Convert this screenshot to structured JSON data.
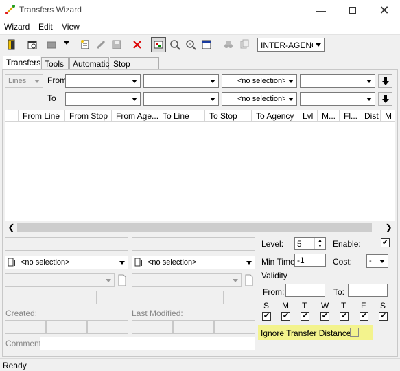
{
  "window": {
    "title": "Transfers Wizard"
  },
  "menu": [
    "Wizard",
    "Edit",
    "View"
  ],
  "toolbar": {
    "agency_select": "INTER-AGENCY"
  },
  "tabs": [
    "Transfers",
    "Tools",
    "Automatic",
    "Stop Clusters"
  ],
  "filters": {
    "lines_label": "Lines",
    "from_label": "From",
    "to_label": "To",
    "from_selection": "<no selection>",
    "to_selection": "<no selection>"
  },
  "columns": [
    "From Line",
    "From Stop",
    "From Age...",
    "To Line",
    "To Stop",
    "To Agency",
    "Lvl",
    "M...",
    "Fl...",
    "Dist",
    "M"
  ],
  "detail": {
    "left_selection": "<no selection>",
    "right_selection": "<no selection>",
    "created_label": "Created:",
    "modified_label": "Last Modified:",
    "comment_label": "Comment:"
  },
  "settings": {
    "level_label": "Level:",
    "level_value": "5",
    "enable_label": "Enable:",
    "min_time_label": "Min Time:",
    "min_time_value": "-1",
    "cost_label": "Cost:",
    "cost_value": "-",
    "validity_label": "Validity",
    "from_label": "From:",
    "to_label": "To:",
    "days": [
      "S",
      "M",
      "T",
      "W",
      "T",
      "F",
      "S"
    ],
    "ignore_label": "Ignore Transfer Distance:",
    "highlight_color": "#f3f38d"
  },
  "status": {
    "text": "Ready"
  }
}
